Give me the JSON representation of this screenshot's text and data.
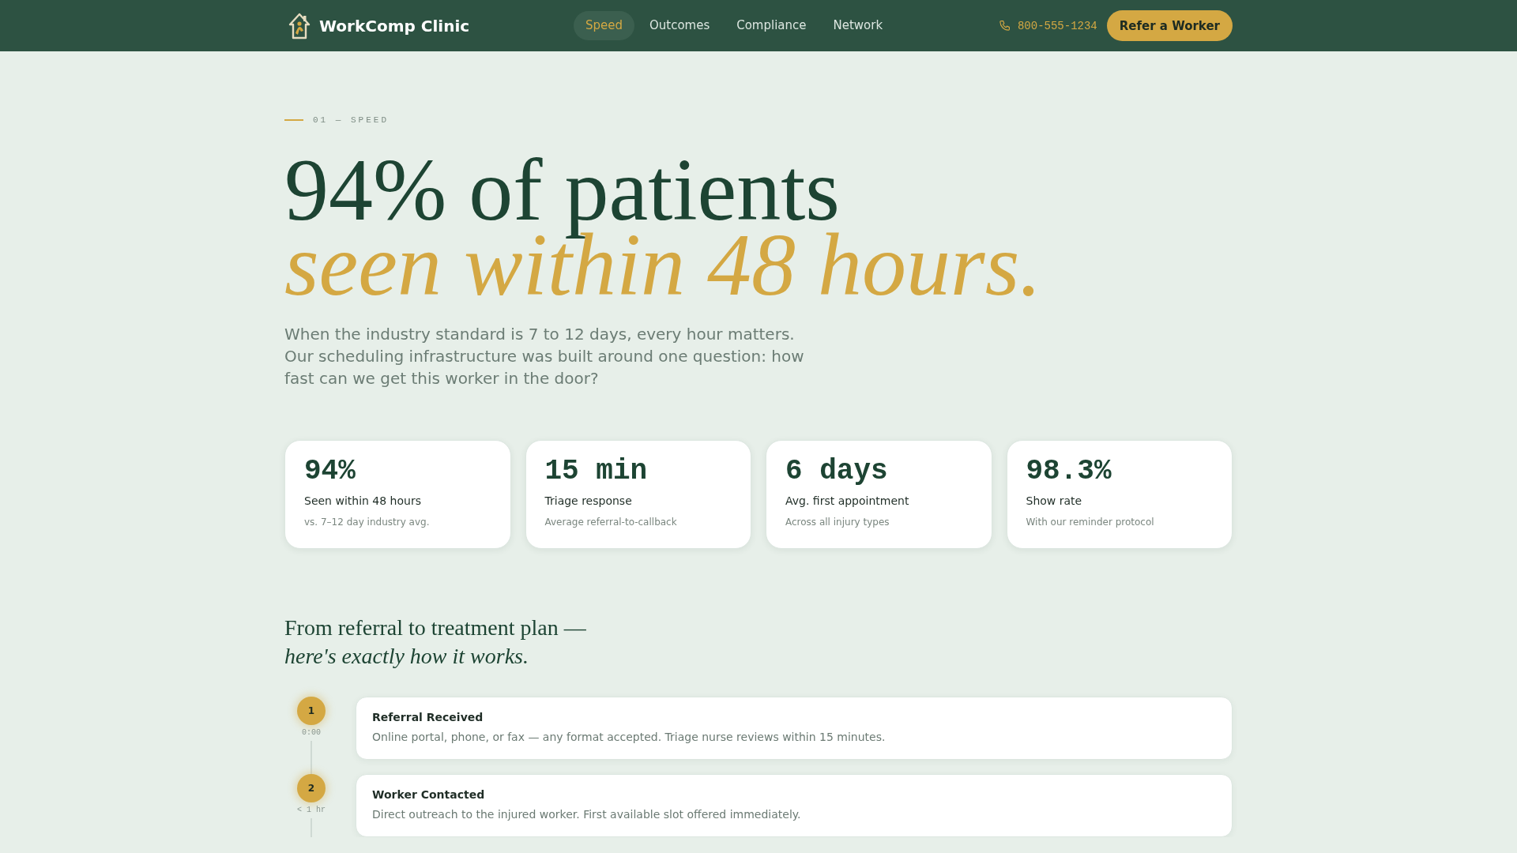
{
  "nav": {
    "brand": "WorkComp Clinic",
    "links": [
      {
        "label": "Speed",
        "selected": true
      },
      {
        "label": "Outcomes",
        "selected": false
      },
      {
        "label": "Compliance",
        "selected": false
      },
      {
        "label": "Network",
        "selected": false
      }
    ],
    "phone": "800-555-1234",
    "cta": "Refer a Worker"
  },
  "hero": {
    "eyebrow": "01 — SPEED",
    "headline": "94% of patients",
    "headline_accent": "seen within 48 hours.",
    "intro": "When the industry standard is 7 to 12 days, every hour matters. Our scheduling infrastructure was built around one question: how fast can we get this worker in the door?"
  },
  "stats": [
    {
      "value": "94%",
      "label": "Seen within 48 hours",
      "note": "vs. 7–12 day industry avg."
    },
    {
      "value": "15 min",
      "label": "Triage response",
      "note": "Average referral-to-callback"
    },
    {
      "value": "6 days",
      "label": "Avg. first appointment",
      "note": "Across all injury types"
    },
    {
      "value": "98.3%",
      "label": "Show rate",
      "note": "With our reminder protocol"
    }
  ],
  "process": {
    "title": "From referral to treatment plan —",
    "title_accent": "here's exactly how it works.",
    "steps": [
      {
        "number": "1",
        "time": "0:00",
        "title": "Referral Received",
        "description": "Online portal, phone, or fax — any format accepted. Triage nurse reviews within 15 minutes."
      },
      {
        "number": "2",
        "time": "< 1 hr",
        "title": "Worker Contacted",
        "description": "Direct outreach to the injured worker. First available slot offered immediately."
      }
    ]
  }
}
